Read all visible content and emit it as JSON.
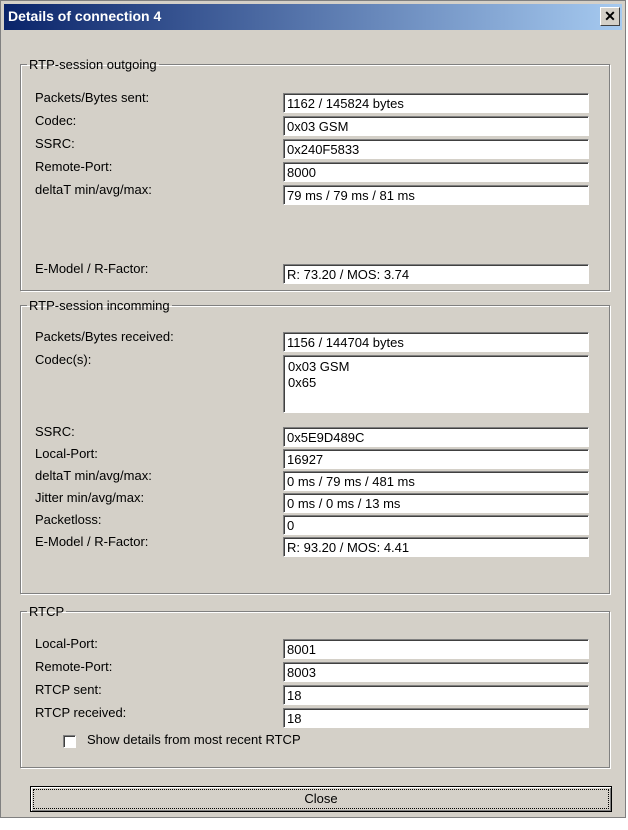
{
  "window": {
    "title": "Details of connection 4",
    "close_glyph": "✕"
  },
  "outgoing": {
    "title": "RTP-session outgoing",
    "fields": [
      {
        "label": "Packets/Bytes sent:",
        "value": "1162 / 145824 bytes"
      },
      {
        "label": "Codec:",
        "value": "0x03 GSM"
      },
      {
        "label": "SSRC:",
        "value": "0x240F5833"
      },
      {
        "label": "Remote-Port:",
        "value": "8000"
      },
      {
        "label": "deltaT min/avg/max:",
        "value": "79 ms / 79 ms / 81 ms"
      },
      {
        "label": "E-Model / R-Factor:",
        "value": "R: 73.20 / MOS: 3.74"
      }
    ]
  },
  "incoming": {
    "title": "RTP-session incomming",
    "fields": [
      {
        "label": "Packets/Bytes received:",
        "value": "1156 / 144704 bytes"
      },
      {
        "label": "Codec(s):",
        "lines": [
          "0x03 GSM",
          "0x65"
        ]
      },
      {
        "label": "SSRC:",
        "value": "0x5E9D489C"
      },
      {
        "label": "Local-Port:",
        "value": "16927"
      },
      {
        "label": "deltaT min/avg/max:",
        "value": "0 ms / 79 ms / 481 ms"
      },
      {
        "label": "Jitter min/avg/max:",
        "value": "0 ms / 0 ms / 13 ms"
      },
      {
        "label": "Packetloss:",
        "value": "0"
      },
      {
        "label": "E-Model / R-Factor:",
        "value": "R: 93.20 / MOS: 4.41"
      }
    ]
  },
  "rtcp": {
    "title": "RTCP",
    "fields": [
      {
        "label": "Local-Port:",
        "value": "8001"
      },
      {
        "label": "Remote-Port:",
        "value": "8003"
      },
      {
        "label": "RTCP sent:",
        "value": "18"
      },
      {
        "label": "RTCP received:",
        "value": "18"
      }
    ],
    "show_details_label": "Show details from most recent RTCP",
    "show_details_checked": false
  },
  "buttons": {
    "close_label": "Close"
  }
}
